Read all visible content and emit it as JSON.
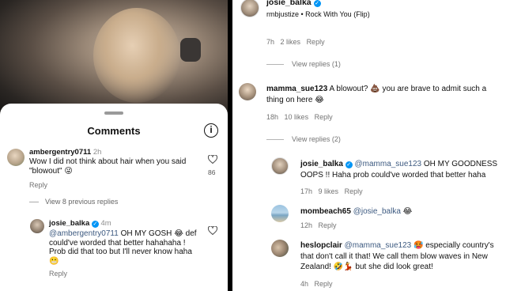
{
  "left": {
    "title": "Comments",
    "info_glyph": "i",
    "comments": [
      {
        "username": "ambergentry0711",
        "time": "2h",
        "text": "Wow I did not think about hair when you said \"blowout\"",
        "emoji": "😜",
        "reply": "Reply",
        "likes": "86"
      }
    ],
    "view_replies": "View 8 previous replies",
    "reply_comment": {
      "username": "josie_balka",
      "verified_glyph": "✓",
      "time": "4m",
      "mention": "@ambergentry0711",
      "text_a": " OH MY GOSH ",
      "emoji_a": "😂",
      "text_b": " def could've worded that better hahahaha ! Prob did that too but I'll never know haha ",
      "emoji_b": "😬",
      "reply": "Reply"
    }
  },
  "right": {
    "header": {
      "username": "josie_balka",
      "verified_glyph": "✓",
      "audio": "rmbjustize • Rock With You (Flip)"
    },
    "top_meta": {
      "time": "7h",
      "likes": "2 likes",
      "reply": "Reply"
    },
    "view_replies_1": "View replies (1)",
    "comment_mamma": {
      "username": "mamma_sue123",
      "text_a": " A blowout? ",
      "emoji_a": "💩",
      "text_b": " you are brave to admit such a thing on here ",
      "emoji_b": "😂",
      "time": "18h",
      "likes": "10 likes",
      "reply": "Reply"
    },
    "view_replies_2": "View replies (2)",
    "reply_josie": {
      "username": "josie_balka",
      "verified_glyph": "✓",
      "mention": "@mamma_sue123",
      "text": " OH MY GOODNESS OOPS !! Haha prob could've worded that better haha",
      "time": "17h",
      "likes": "9 likes",
      "reply": "Reply"
    },
    "reply_mombeach": {
      "username": "mombeach65",
      "mention": "@josie_balka",
      "emoji": "😂",
      "time": "12h",
      "reply": "Reply"
    },
    "reply_heslop": {
      "username": "heslopclair",
      "mention": "@mamma_sue123",
      "emoji_a": "🥵",
      "text_a": " especially country's that don't call it that! We call them blow waves in New Zealand! ",
      "emoji_b": "🤣",
      "emoji_c": "💃",
      "text_b": " but she did look great!",
      "time": "4h",
      "reply": "Reply"
    }
  },
  "colors": {
    "mention": "#3d5a80",
    "verified": "#0095f6",
    "meta": "#737373"
  }
}
